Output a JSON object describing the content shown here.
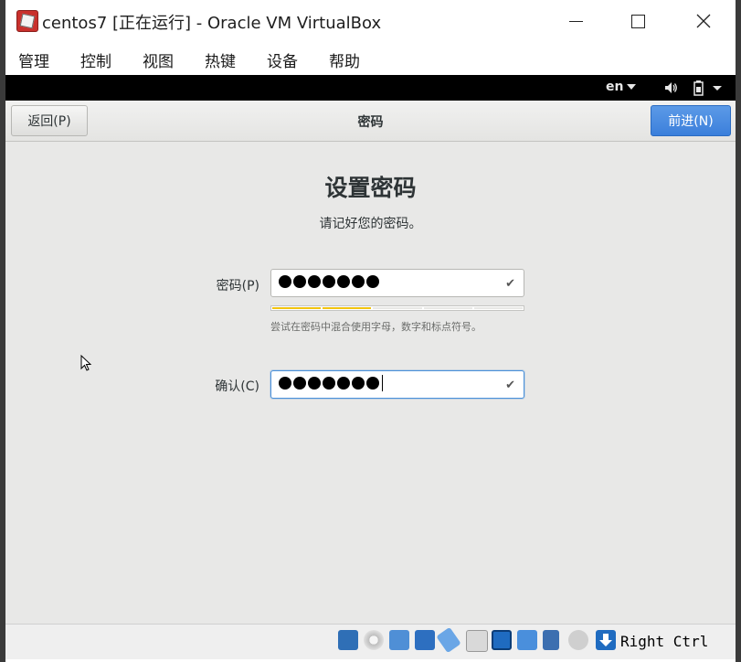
{
  "window": {
    "title": "centos7 [正在运行] - Oracle VM VirtualBox",
    "icon": "virtualbox-icon"
  },
  "menubar": {
    "items": [
      "管理",
      "控制",
      "视图",
      "热键",
      "设备",
      "帮助"
    ]
  },
  "vm_topbar": {
    "language": "en",
    "icons": [
      "volume-icon",
      "battery-icon"
    ]
  },
  "installer": {
    "back_label": "返回(P)",
    "header_title": "密码",
    "next_label": "前进(N)",
    "title": "设置密码",
    "subtitle": "请记好您的密码。",
    "password": {
      "label": "密码(P)",
      "masked_chars": 7,
      "strength_segments": 5,
      "strength_filled": 2,
      "strength_color": "#f1c40f",
      "hint": "尝试在密码中混合使用字母，数字和标点符号。"
    },
    "confirm": {
      "label": "确认(C)",
      "masked_chars": 7
    }
  },
  "statusbar": {
    "host_key": "Right Ctrl",
    "icons": [
      "hard-disk-icon",
      "optical-drive-icon",
      "audio-icon",
      "network-icon",
      "usb-icon",
      "shared-folders-icon",
      "display-icon",
      "video-capture-icon",
      "cpu-virtualization-icon",
      "mouse-integration-icon",
      "host-key-arrow-icon"
    ]
  },
  "colors": {
    "accent_blue": "#3b7fdb",
    "focus_ring": "#4a90d9"
  }
}
